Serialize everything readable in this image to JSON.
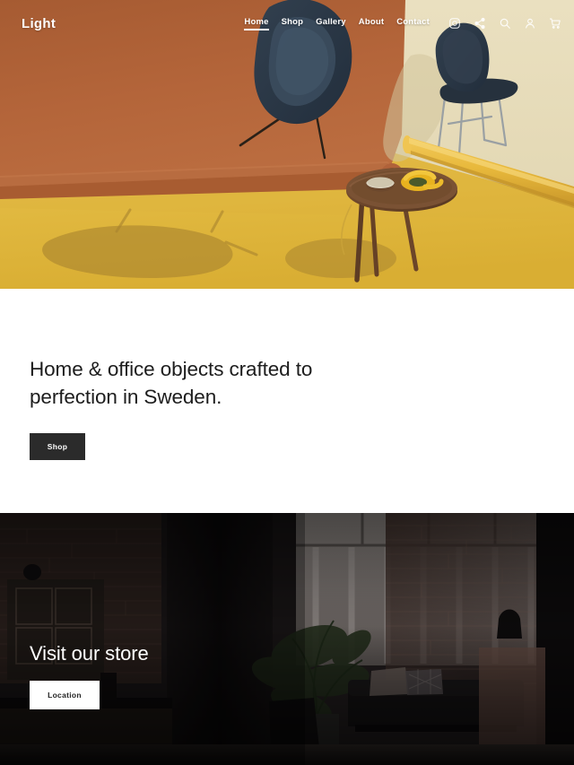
{
  "site": {
    "logo": "Light",
    "theme": {
      "hero_backdrop": "#b4653a",
      "hero_floor": "#e3b941",
      "hero_wall": "#e6dcba",
      "chair_navy": "#2b3a4a",
      "accent_dark": "#2b2b2b",
      "text_dark": "#1d1d1d",
      "text_light": "#ffffff"
    }
  },
  "nav": {
    "links": [
      {
        "label": "Home",
        "active": true
      },
      {
        "label": "Shop",
        "active": false
      },
      {
        "label": "Gallery",
        "active": false
      },
      {
        "label": "About",
        "active": false
      },
      {
        "label": "Contact",
        "active": false
      }
    ],
    "icons": [
      {
        "name": "instagram-icon"
      },
      {
        "name": "share-icon"
      },
      {
        "name": "search-icon"
      },
      {
        "name": "account-icon"
      },
      {
        "name": "cart-icon"
      }
    ]
  },
  "hero": {
    "alt": "Terracotta paper backdrop curving onto a yellow floor with a navy lounge chair, a navy side chair, a round walnut table with a bowl and yellow objects, and a rolled yellow paper"
  },
  "intro": {
    "headline_line1": "Home & office objects crafted to",
    "headline_line2": "perfection in Sweden.",
    "cta_label": "Shop"
  },
  "store": {
    "title": "Visit our store",
    "cta_label": "Location",
    "alt": "Dimly lit loft showroom with exposed brick walls, a dark sofa with patterned cushions, large plants and tall windows"
  }
}
